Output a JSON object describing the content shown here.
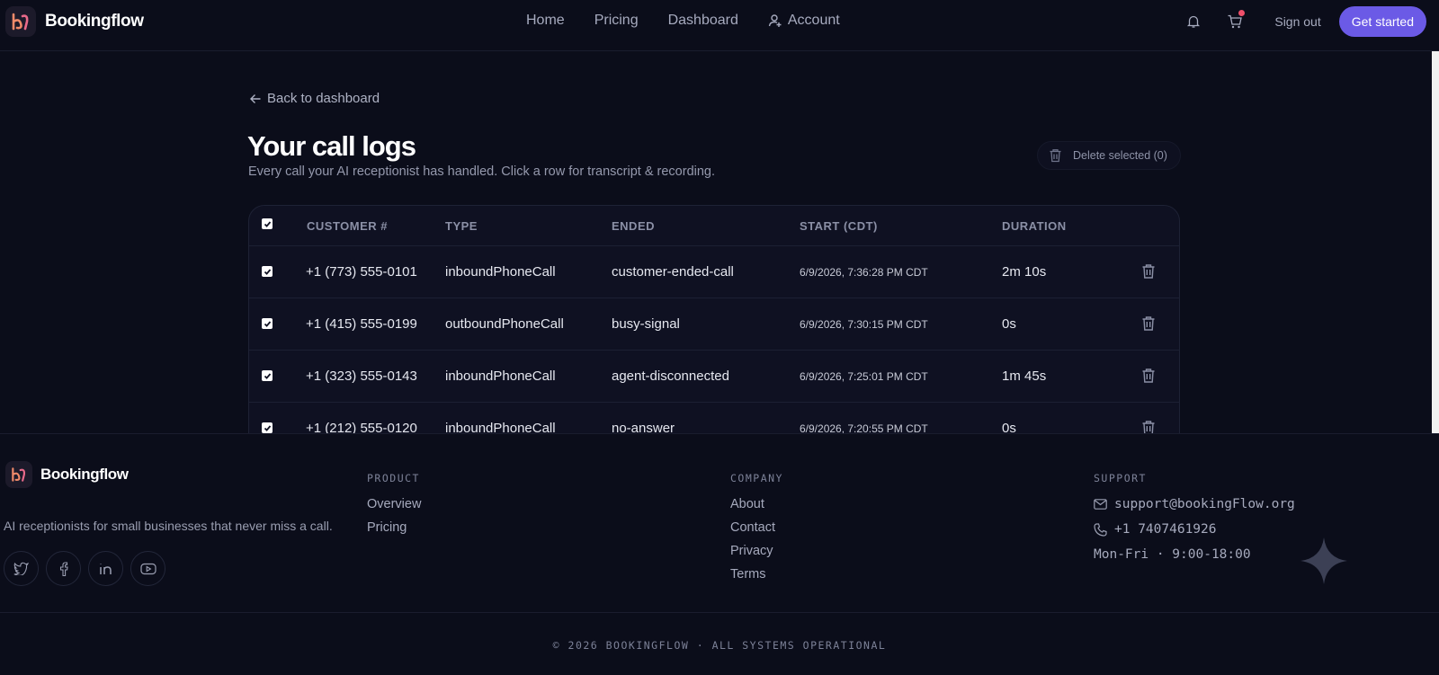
{
  "nav": {
    "brand": "Bookingflow",
    "links": [
      {
        "label": "Home"
      },
      {
        "label": "Pricing"
      },
      {
        "label": "Dashboard"
      },
      {
        "label": "Account",
        "icon": "user-icon"
      }
    ],
    "sign_out": "Sign out",
    "cta": "Get started",
    "icons": [
      "bell-icon",
      "cart-icon"
    ]
  },
  "page": {
    "back_label": "Back to dashboard",
    "title": "Your call logs",
    "subtitle": "Every call your AI receptionist has handled. Click a row for transcript & recording.",
    "delete_selected": "Delete selected (0)"
  },
  "table": {
    "headers": [
      "CUSTOMER #",
      "TYPE",
      "ENDED",
      "START (CDT)",
      "DURATION"
    ],
    "rows": [
      {
        "customer": "+1 (773) 555-0101",
        "type": "inboundPhoneCall",
        "ended": "customer-ended-call",
        "start": "6/9/2026, 7:36:28 PM CDT",
        "duration": "2m 10s"
      },
      {
        "customer": "+1 (415) 555-0199",
        "type": "outboundPhoneCall",
        "ended": "busy-signal",
        "start": "6/9/2026, 7:30:15 PM CDT",
        "duration": "0s"
      },
      {
        "customer": "+1 (323) 555-0143",
        "type": "inboundPhoneCall",
        "ended": "agent-disconnected",
        "start": "6/9/2026, 7:25:01 PM CDT",
        "duration": "1m 45s"
      },
      {
        "customer": "+1 (212) 555-0120",
        "type": "inboundPhoneCall",
        "ended": "no-answer",
        "start": "6/9/2026, 7:20:55 PM CDT",
        "duration": "0s"
      }
    ]
  },
  "footer": {
    "brand": "Bookingflow",
    "tagline": "AI receptionists for small businesses that never miss a call.",
    "product_head": "PRODUCT",
    "product_links": [
      "Overview",
      "Pricing"
    ],
    "company_head": "COMPANY",
    "company_links": [
      "About",
      "Contact",
      "Privacy",
      "Terms"
    ],
    "support_head": "SUPPORT",
    "email": "support@bookingFlow.org",
    "phone": "+1 7407461926",
    "hours": "Mon-Fri · 9:00-18:00",
    "copyright": "© 2026 BOOKINGFLOW · ALL SYSTEMS OPERATIONAL",
    "socials": [
      "twitter-icon",
      "facebook-icon",
      "linkedin-icon",
      "youtube-icon"
    ]
  },
  "colors": {
    "accent": "#6b5ae6",
    "background": "#0b0d1a",
    "notification": "#ef4f6a"
  }
}
